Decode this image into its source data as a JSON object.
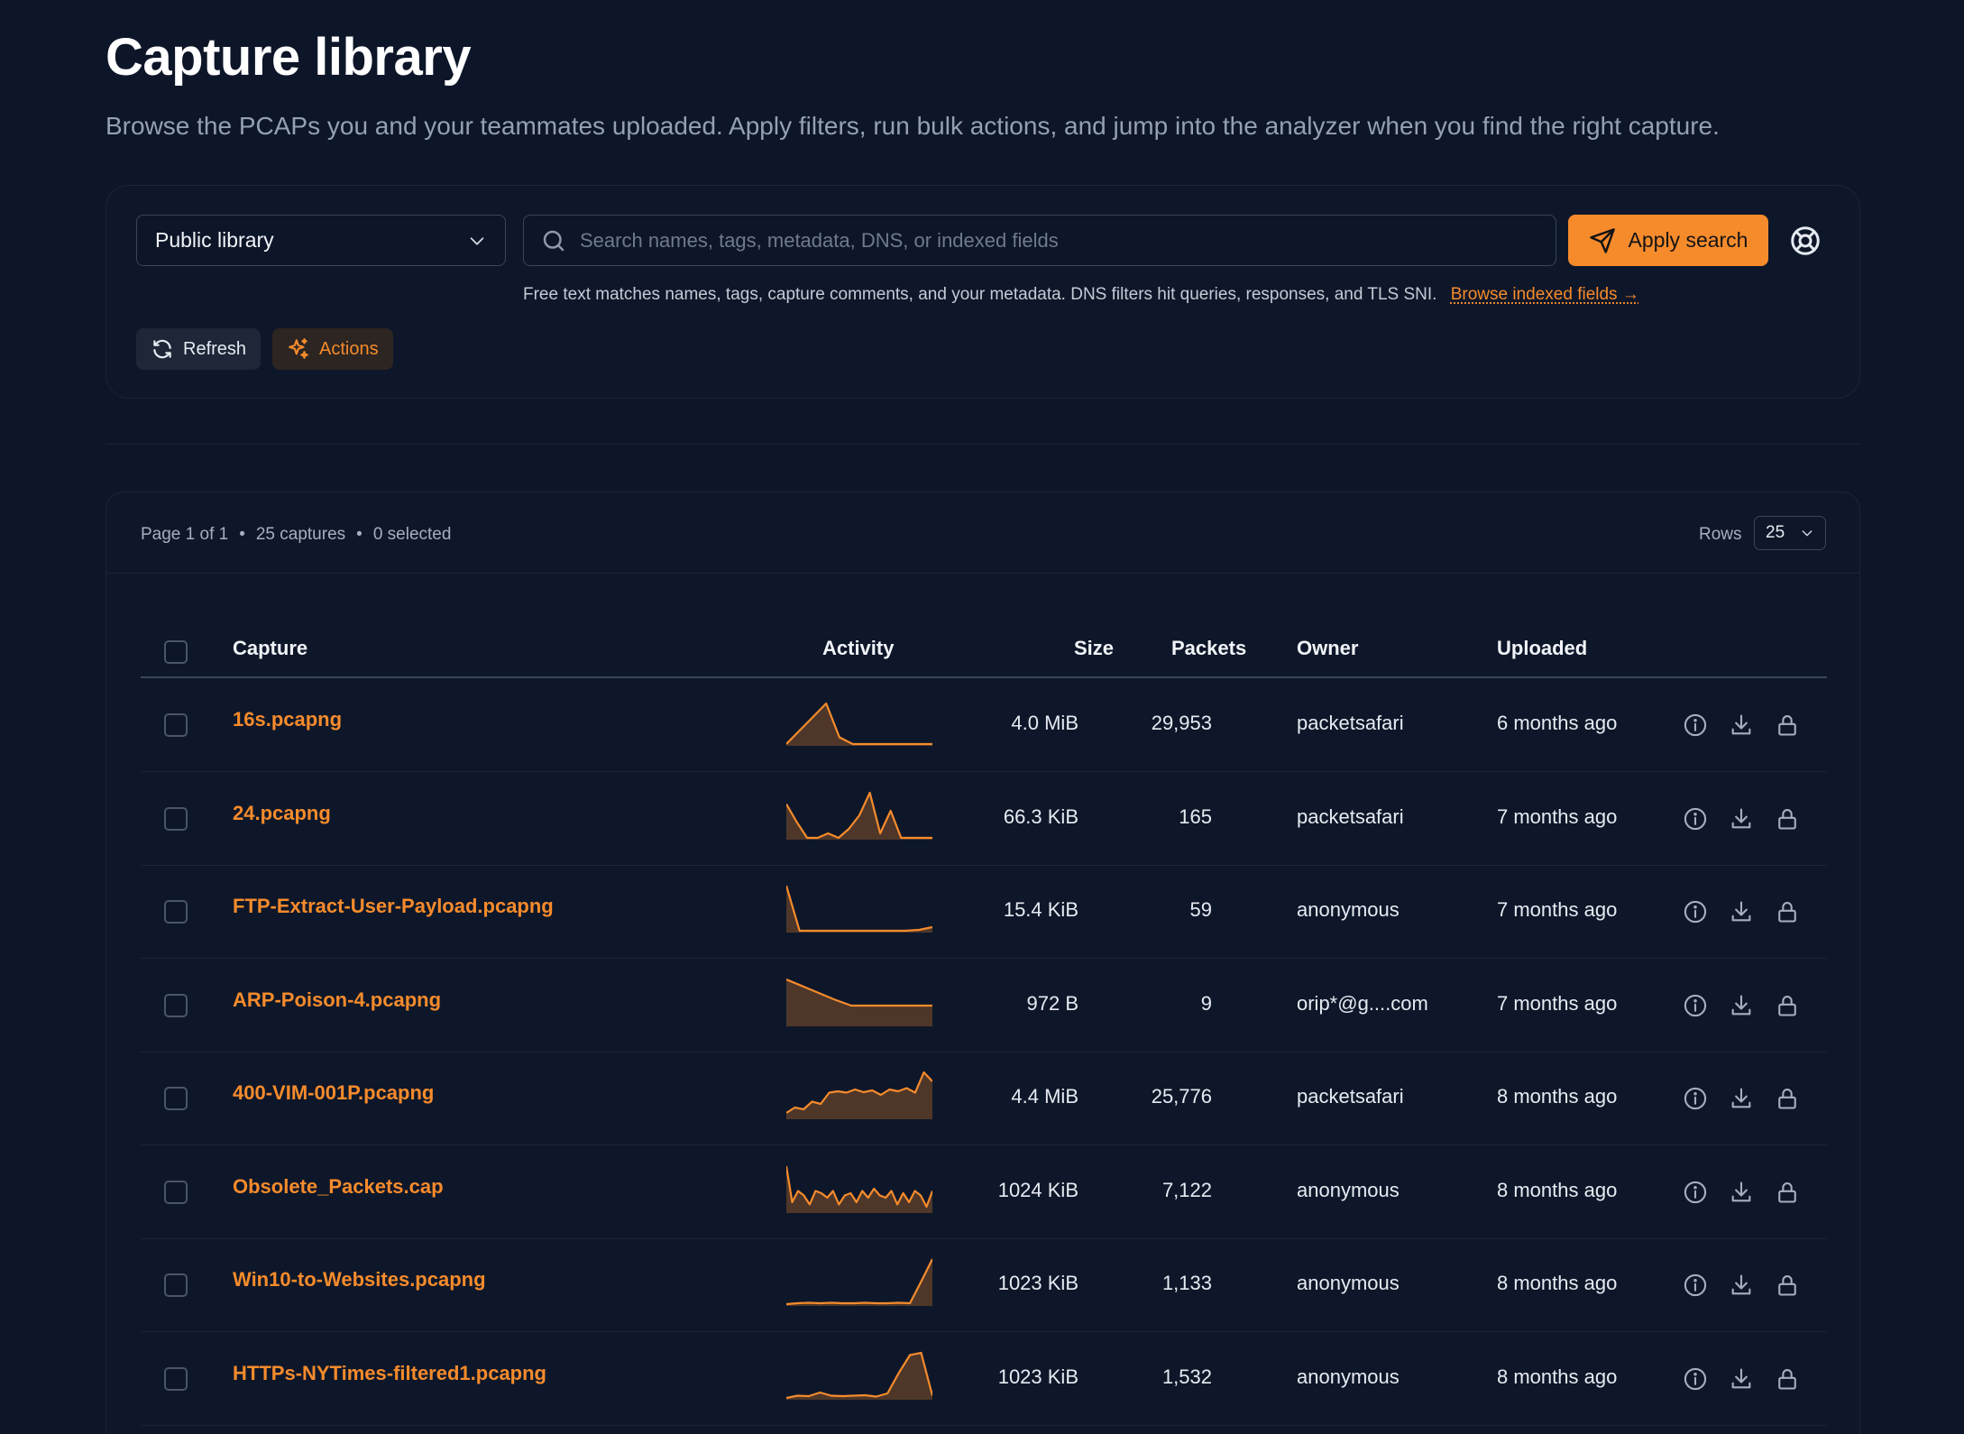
{
  "page": {
    "title": "Capture library",
    "subtitle": "Browse the PCAPs you and your teammates uploaded. Apply filters, run bulk actions, and jump into the analyzer when you find the right capture."
  },
  "filters": {
    "library_select": "Public library",
    "search_placeholder": "Search names, tags, metadata, DNS, or indexed fields",
    "apply_label": "Apply search",
    "hint_text": "Free text matches names, tags, capture comments, and your metadata.  DNS filters hit queries, responses, and TLS SNI.",
    "hint_link": "Browse indexed fields →",
    "refresh_label": "Refresh",
    "actions_label": "Actions"
  },
  "table": {
    "page_info": "Page 1 of 1",
    "captures_count": "25 captures",
    "selected_count": "0 selected",
    "rows_label": "Rows",
    "rows_value": "25",
    "columns": {
      "capture": "Capture",
      "activity": "Activity",
      "size": "Size",
      "packets": "Packets",
      "owner": "Owner",
      "uploaded": "Uploaded"
    },
    "rows": [
      {
        "name": "16s.pcapng",
        "size": "4.0 MiB",
        "packets": "29,953",
        "owner": "packetsafari",
        "uploaded": "6 months ago",
        "activity": [
          0,
          0.3,
          0.6,
          0.9,
          0.15,
          0,
          0,
          0,
          0,
          0,
          0,
          0
        ]
      },
      {
        "name": "24.pcapng",
        "size": "66.3 KiB",
        "packets": "165",
        "owner": "packetsafari",
        "uploaded": "7 months ago",
        "activity": [
          0.75,
          0.35,
          0,
          0,
          0.1,
          0,
          0.2,
          0.5,
          1,
          0.1,
          0.6,
          0,
          0,
          0,
          0
        ]
      },
      {
        "name": "FTP-Extract-User-Payload.pcapng",
        "size": "15.4 KiB",
        "packets": "59",
        "owner": "anonymous",
        "uploaded": "7 months ago",
        "activity": [
          1,
          0,
          0,
          0,
          0,
          0,
          0,
          0,
          0,
          0,
          0.02,
          0.08
        ]
      },
      {
        "name": "ARP-Poison-4.pcapng",
        "size": "972 B",
        "packets": "9",
        "owner": "orip*@g....com",
        "uploaded": "7 months ago",
        "activity": [
          1,
          0.85,
          0.7,
          0.55,
          0.42,
          0.42,
          0.42,
          0.42,
          0.42,
          0.42
        ]
      },
      {
        "name": "400-VIM-001P.pcapng",
        "size": "4.4 MiB",
        "packets": "25,776",
        "owner": "packetsafari",
        "uploaded": "8 months ago",
        "activity": [
          0.1,
          0.22,
          0.18,
          0.35,
          0.3,
          0.55,
          0.58,
          0.55,
          0.62,
          0.56,
          0.6,
          0.5,
          0.62,
          0.58,
          0.65,
          0.55,
          1,
          0.8
        ]
      },
      {
        "name": "Obsolete_Packets.cap",
        "size": "1024 KiB",
        "packets": "7,122",
        "owner": "anonymous",
        "uploaded": "8 months ago",
        "activity": [
          1,
          0.2,
          0.45,
          0.35,
          0.15,
          0.45,
          0.4,
          0.3,
          0.45,
          0.15,
          0.35,
          0.4,
          0.2,
          0.45,
          0.3,
          0.5,
          0.35,
          0.3,
          0.45,
          0.15,
          0.4,
          0.2,
          0.45,
          0.35,
          0.1,
          0.45
        ]
      },
      {
        "name": "Win10-to-Websites.pcapng",
        "size": "1023 KiB",
        "packets": "1,133",
        "owner": "anonymous",
        "uploaded": "8 months ago",
        "activity": [
          0,
          0.02,
          0.03,
          0.02,
          0.03,
          0.02,
          0.02,
          0.03,
          0.02,
          0.02,
          0.03,
          0.02,
          0.5,
          1
        ]
      },
      {
        "name": "HTTPs-NYTimes-filtered1.pcapng",
        "size": "1023 KiB",
        "packets": "1,532",
        "owner": "anonymous",
        "uploaded": "8 months ago",
        "activity": [
          0,
          0.05,
          0.04,
          0.12,
          0.05,
          0.04,
          0.05,
          0.06,
          0.03,
          0.1,
          0.55,
          0.95,
          1,
          0.05
        ]
      }
    ]
  },
  "colors": {
    "accent": "#f68b2c",
    "background": "#0d1528"
  },
  "icons": {
    "select_chevron": "chevron-down-icon",
    "search": "search-icon",
    "apply": "paper-plane-icon",
    "help": "life-buoy-icon",
    "refresh": "refresh-icon",
    "actions": "sparkles-icon",
    "row_info": "info-icon",
    "row_download": "download-icon",
    "row_lock": "lock-icon"
  }
}
